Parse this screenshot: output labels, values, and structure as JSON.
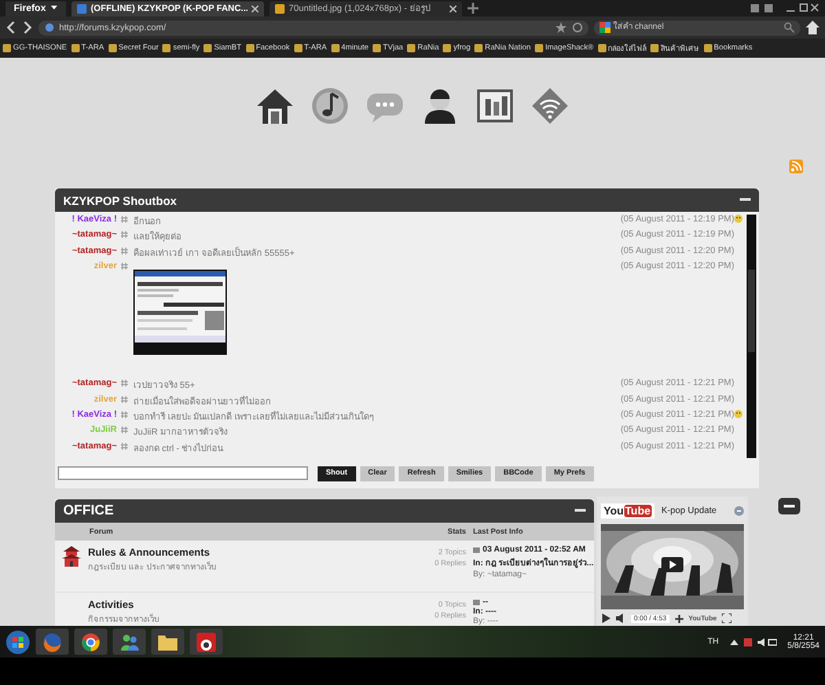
{
  "browser": {
    "menu_button": "Firefox",
    "tabs": [
      {
        "title": "(OFFLINE) KZYKPOP (K-POP FANC...",
        "selected": true
      },
      {
        "title": "70untitled.jpg (1,024x768px) - ย่อรูป",
        "selected": false
      }
    ],
    "address": "http://forums.kzykpop.com/",
    "search_placeholder": "ใส่คำ channel",
    "bookmarks": [
      "GG-THAISONE",
      "T-ARA",
      "Secret Four",
      "semi-fly",
      "SiamBT",
      "Facebook",
      "T-ARA",
      "4minute",
      "TVjaa",
      "RaNia",
      "yfrog",
      "RaNia Nation",
      "ImageShack®",
      "กล่องใส่ไฟล์",
      "สินค้าพิเศษ",
      "Bookmarks"
    ]
  },
  "shoutbox": {
    "title": "KZYKPOP Shoutbox",
    "shouts": [
      {
        "kind": "text",
        "name": "! KaeViza !",
        "color": "#8a2be2",
        "message": "อีกนอก",
        "time": "(05 August 2011 - 12:19 PM)",
        "smiley": true
      },
      {
        "kind": "text",
        "name": "~tatamag~",
        "color": "#b22222",
        "message": "แลยให้คุยต่อ",
        "time": "(05 August 2011 - 12:19 PM)",
        "smiley": false
      },
      {
        "kind": "text",
        "name": "~tatamag~",
        "color": "#b22222",
        "message": "คือผลเท่าเวย์ เกา จอดีเลยเป็นหลัก 55555+",
        "time": "(05 August 2011 - 12:20 PM)",
        "smiley": false
      },
      {
        "name": "zilver",
        "color": "#e8a33a",
        "time": "(05 August 2011 - 12:20 PM)",
        "smiley": false
      },
      {
        "kind": "text",
        "name": "~tatamag~",
        "color": "#b22222",
        "message": "เวปยาวจริง 55+",
        "time": "(05 August 2011 - 12:21 PM)",
        "smiley": false
      },
      {
        "kind": "text",
        "name": "zilver",
        "color": "#e8a33a",
        "message": "ถ่ายเมื่อนใส่พอดีจอผ่านยาวที่ไม่ออก",
        "time": "(05 August 2011 - 12:21 PM)",
        "smiley": false
      },
      {
        "kind": "text",
        "name": "! KaeViza !",
        "color": "#8a2be2",
        "message": "บอกทำรี เลยปะ มันแปลกดี เพราะเลยที่ไม่เลยและไม่มีส่วนเกินใดๆ",
        "time": "(05 August 2011 - 12:21 PM)",
        "smiley": true
      },
      {
        "kind": "text",
        "name": "JuJiiR",
        "color": "#7ccd3c",
        "message": "JuJiiR มากอาหารตัวจริง",
        "time": "(05 August 2011 - 12:21 PM)",
        "smiley": false
      },
      {
        "kind": "text",
        "name": "~tatamag~",
        "color": "#b22222",
        "message": "ลองกด ctrl - ช่างไปก่อน",
        "time": "(05 August 2011 - 12:21 PM)",
        "smiley": false
      }
    ],
    "buttons": [
      {
        "label": "Shout",
        "kind": "primary"
      },
      {
        "label": "Clear",
        "kind": "secondary"
      },
      {
        "label": "Refresh",
        "kind": "secondary"
      },
      {
        "label": "Smilies",
        "kind": "secondary"
      },
      {
        "label": "BBCode",
        "kind": "secondary"
      },
      {
        "label": "My Prefs",
        "kind": "secondary"
      }
    ]
  },
  "office": {
    "title": "OFFICE",
    "columns": [
      "Forum",
      "Stats",
      "Last Post Info"
    ],
    "forums": [
      {
        "name": "Rules & Announcements",
        "description": "กฎระเบียบ และ ประกาศจากทางเว็บ",
        "topics": "2 Topics",
        "replies": "0 Replies",
        "last_date": "03 August 2011 - 02:52 AM",
        "last_in": "In: กฎ ระเบียบต่างๆในการอยู่ร่ว...",
        "last_by": "By: ~tatamag~"
      },
      {
        "name": "Activities",
        "description": "กิจกรรมจากทางเว็บ",
        "topics": "0 Topics",
        "replies": "0 Replies",
        "last_date": "--",
        "last_in": "In: ----",
        "last_by": "By: ----"
      }
    ]
  },
  "youtube": {
    "logo": [
      "You",
      "Tube"
    ],
    "title": "K-pop Update",
    "time": "0:00 / 4:53",
    "control_logo": "YouTube"
  },
  "taskbar": {
    "language": "TH",
    "time": "12:21",
    "date": "5/8/2554"
  }
}
